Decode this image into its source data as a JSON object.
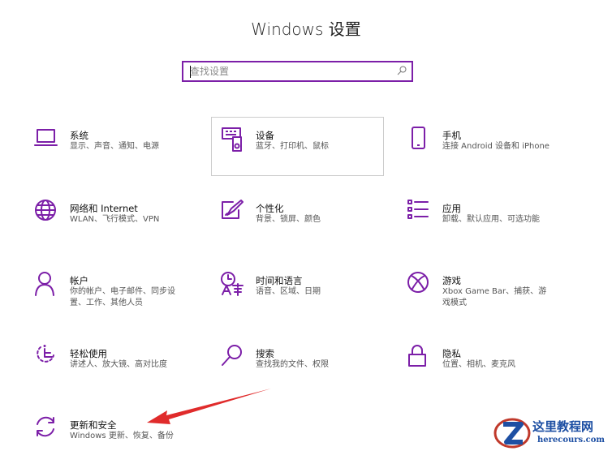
{
  "window": {
    "title": "Windows 设置"
  },
  "search": {
    "placeholder": "查找设置"
  },
  "tiles": [
    {
      "name": "系统",
      "desc": "显示、声音、通知、电源",
      "icon": "laptop-icon"
    },
    {
      "name": "设备",
      "desc": "蓝牙、打印机、鼠标",
      "icon": "keyboard-speaker-icon"
    },
    {
      "name": "手机",
      "desc": "连接 Android 设备和 iPhone",
      "icon": "phone-icon"
    },
    {
      "name": "网络和 Internet",
      "desc": "WLAN、飞行模式、VPN",
      "icon": "globe-icon"
    },
    {
      "name": "个性化",
      "desc": "背景、锁屏、颜色",
      "icon": "paint-icon"
    },
    {
      "name": "应用",
      "desc": "卸载、默认应用、可选功能",
      "icon": "apps-list-icon"
    },
    {
      "name": "帐户",
      "desc": "你的帐户、电子邮件、同步设置、工作、其他人员",
      "icon": "person-icon"
    },
    {
      "name": "时间和语言",
      "desc": "语音、区域、日期",
      "icon": "time-language-icon"
    },
    {
      "name": "游戏",
      "desc": "Xbox Game Bar、捕获、游戏模式",
      "icon": "xbox-icon"
    },
    {
      "name": "轻松使用",
      "desc": "讲述人、放大镜、高对比度",
      "icon": "accessibility-icon"
    },
    {
      "name": "搜索",
      "desc": "查找我的文件、权限",
      "icon": "search-icon"
    },
    {
      "name": "隐私",
      "desc": "位置、相机、麦克风",
      "icon": "lock-icon"
    },
    {
      "name": "更新和安全",
      "desc": "Windows 更新、恢复、备份",
      "icon": "sync-icon"
    }
  ],
  "watermark": {
    "text": "这里教程网",
    "url": "herecours.com"
  },
  "colors": {
    "accent": "#7c1fa8",
    "arrow": "#e02b2b",
    "watermark": "#1d4fa3"
  }
}
